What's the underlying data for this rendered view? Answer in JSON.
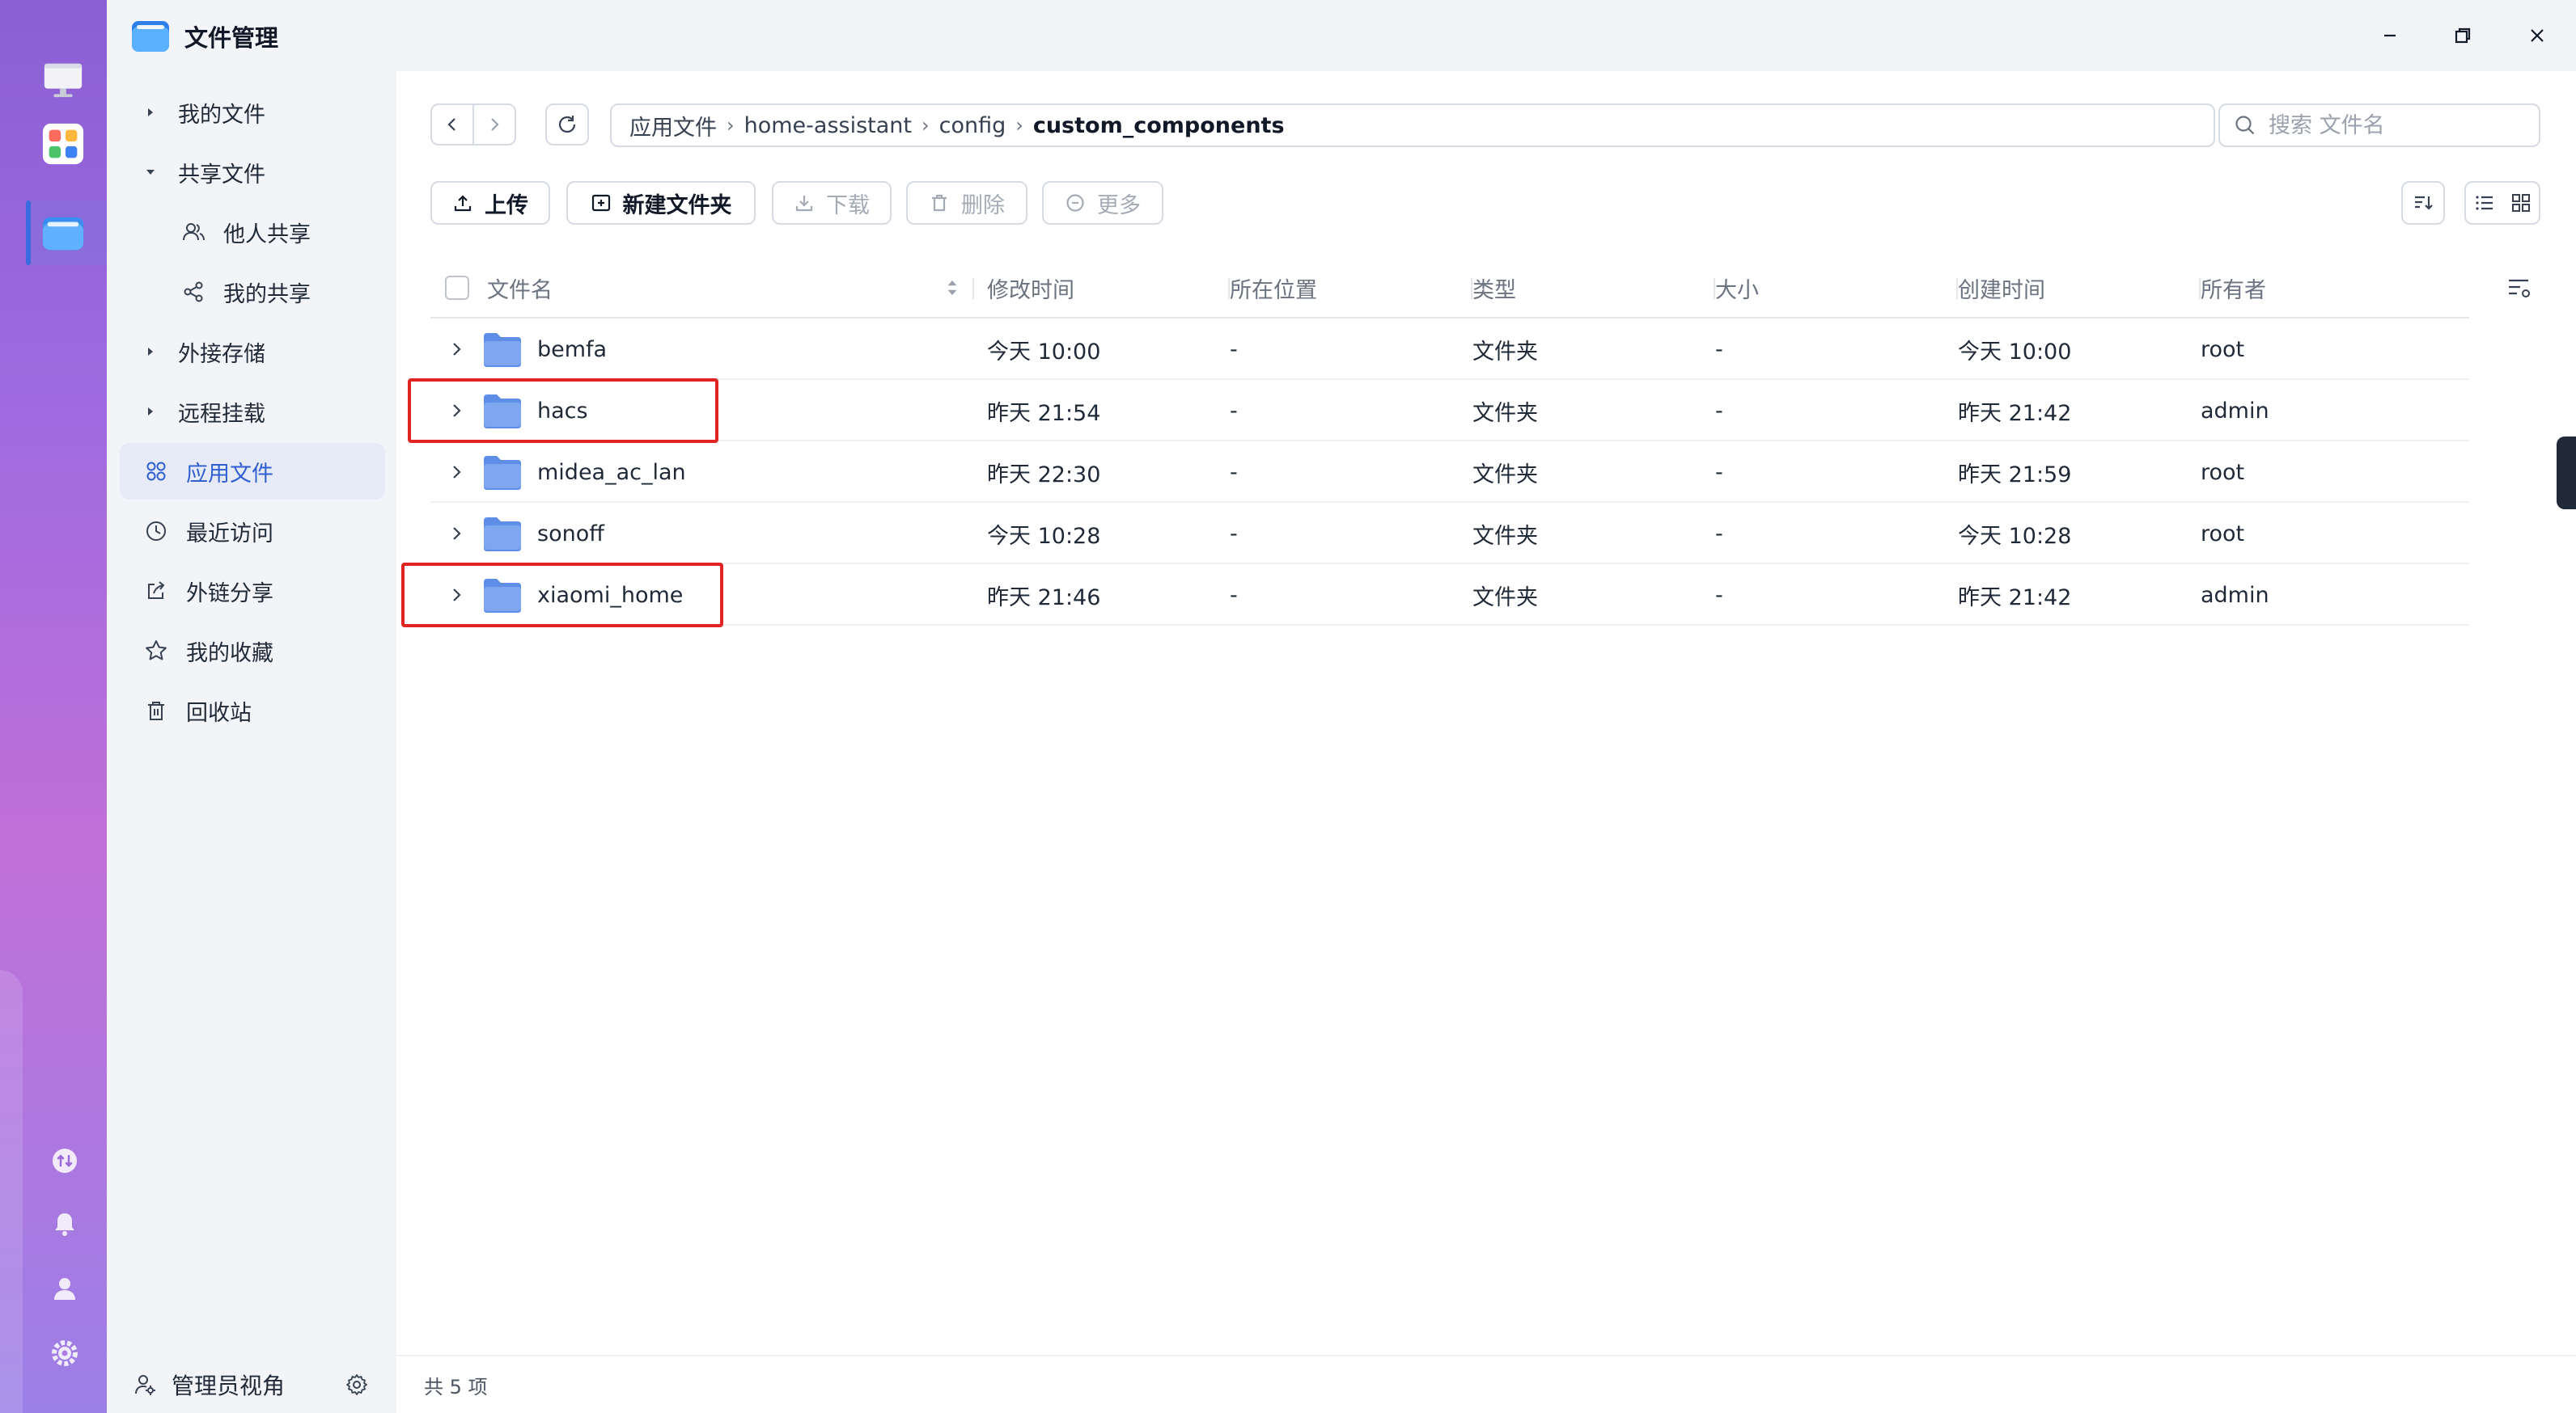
{
  "window": {
    "title": "文件管理"
  },
  "sidebar": {
    "items": [
      {
        "label": "我的文件"
      },
      {
        "label": "共享文件"
      },
      {
        "label": "他人共享"
      },
      {
        "label": "我的共享"
      },
      {
        "label": "外接存储"
      },
      {
        "label": "远程挂载"
      },
      {
        "label": "应用文件"
      },
      {
        "label": "最近访问"
      },
      {
        "label": "外链分享"
      },
      {
        "label": "我的收藏"
      },
      {
        "label": "回收站"
      }
    ],
    "active_index": 6,
    "footer_label": "管理员视角"
  },
  "breadcrumb": {
    "parts": [
      "应用文件",
      "home-assistant",
      "config",
      "custom_components"
    ],
    "separator": "›"
  },
  "search": {
    "placeholder": "搜索 文件名"
  },
  "toolbar": {
    "upload": "上传",
    "new_folder": "新建文件夹",
    "download": "下载",
    "delete": "删除",
    "more": "更多"
  },
  "table": {
    "columns": [
      "文件名",
      "修改时间",
      "所在位置",
      "类型",
      "大小",
      "创建时间",
      "所有者"
    ],
    "rows": [
      {
        "name": "bemfa",
        "modified": "今天 10:00",
        "location": "-",
        "type": "文件夹",
        "size": "-",
        "created": "今天 10:00",
        "owner": "root",
        "highlighted": false
      },
      {
        "name": "hacs",
        "modified": "昨天 21:54",
        "location": "-",
        "type": "文件夹",
        "size": "-",
        "created": "昨天 21:42",
        "owner": "admin",
        "highlighted": true
      },
      {
        "name": "midea_ac_lan",
        "modified": "昨天 22:30",
        "location": "-",
        "type": "文件夹",
        "size": "-",
        "created": "昨天 21:59",
        "owner": "root",
        "highlighted": false
      },
      {
        "name": "sonoff",
        "modified": "今天 10:28",
        "location": "-",
        "type": "文件夹",
        "size": "-",
        "created": "今天 10:28",
        "owner": "root",
        "highlighted": false
      },
      {
        "name": "xiaomi_home",
        "modified": "昨天 21:46",
        "location": "-",
        "type": "文件夹",
        "size": "-",
        "created": "昨天 21:42",
        "owner": "admin",
        "highlighted": true
      }
    ]
  },
  "status": {
    "count_text": "共 5 项"
  },
  "colors": {
    "accent": "#2f5fd0",
    "folder": "#7fa6f0",
    "highlight_box": "#e02424",
    "sidebar_bg": "#f3f4f8"
  }
}
